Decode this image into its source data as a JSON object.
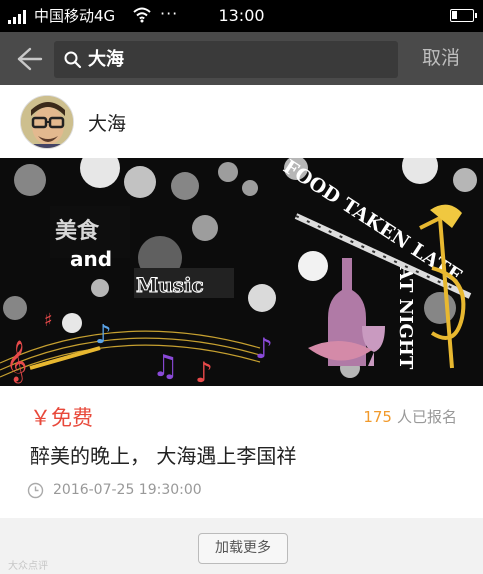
{
  "status_bar": {
    "carrier": "中国移动4G",
    "dots": "···",
    "time": "13:00"
  },
  "search": {
    "query": "大海",
    "cancel_label": "取消",
    "icons": {
      "back": "back-arrow-icon",
      "search": "search-icon"
    }
  },
  "organizer": {
    "name": "大海",
    "avatar_icon": "avatar"
  },
  "banner": {
    "text_meishi": "美食",
    "text_and": "and",
    "text_music": "Music",
    "text_food": "FOOD TAKEN LATE",
    "text_night": "AT NIGHT"
  },
  "event": {
    "price": "￥免费",
    "signup_count": "175",
    "signup_label": "人已报名",
    "title": "醉美的晚上， 大海遇上李国祥",
    "datetime": "2016-07-25 19:30:00",
    "colors": {
      "price": "#e8493b",
      "count": "#f19a2c"
    }
  },
  "load_more_label": "加载更多",
  "watermark": "大众点评"
}
